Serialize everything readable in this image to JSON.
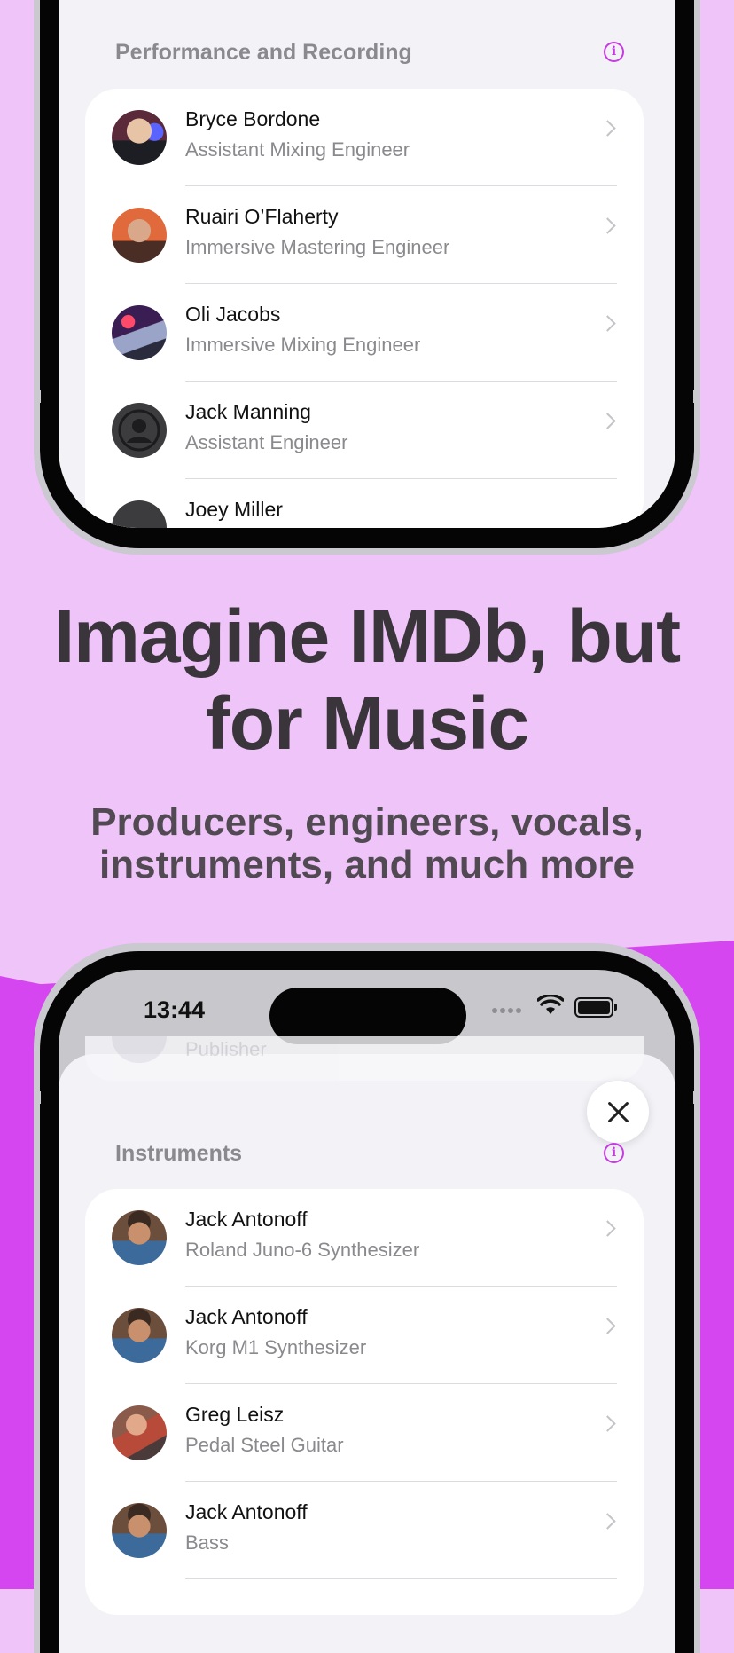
{
  "top_screen": {
    "section_title": "Performance and Recording",
    "people": [
      {
        "name": "Bryce Bordone",
        "role": "Assistant Mixing Engineer"
      },
      {
        "name": "Ruairi O’Flaherty",
        "role": "Immersive Mastering Engineer"
      },
      {
        "name": "Oli Jacobs",
        "role": "Immersive Mixing Engineer"
      },
      {
        "name": "Jack Manning",
        "role": "Assistant Engineer"
      },
      {
        "name": "Joey Miller",
        "role": ""
      }
    ]
  },
  "headline": "Imagine IMDb, but for Music",
  "subheadline": "Producers, engineers, vocals, instruments, and much more",
  "bottom_screen": {
    "status_time": "13:44",
    "faded_role": "Publisher",
    "section_title": "Instruments",
    "people": [
      {
        "name": "Jack Antonoff",
        "role": "Roland Juno-6 Synthesizer"
      },
      {
        "name": "Jack Antonoff",
        "role": "Korg M1 Synthesizer"
      },
      {
        "name": "Greg Leisz",
        "role": "Pedal Steel Guitar"
      },
      {
        "name": "Jack Antonoff",
        "role": "Bass"
      }
    ]
  },
  "colors": {
    "background": "#efc4f8",
    "accent": "#d646f0",
    "info_icon": "#c53be0"
  }
}
